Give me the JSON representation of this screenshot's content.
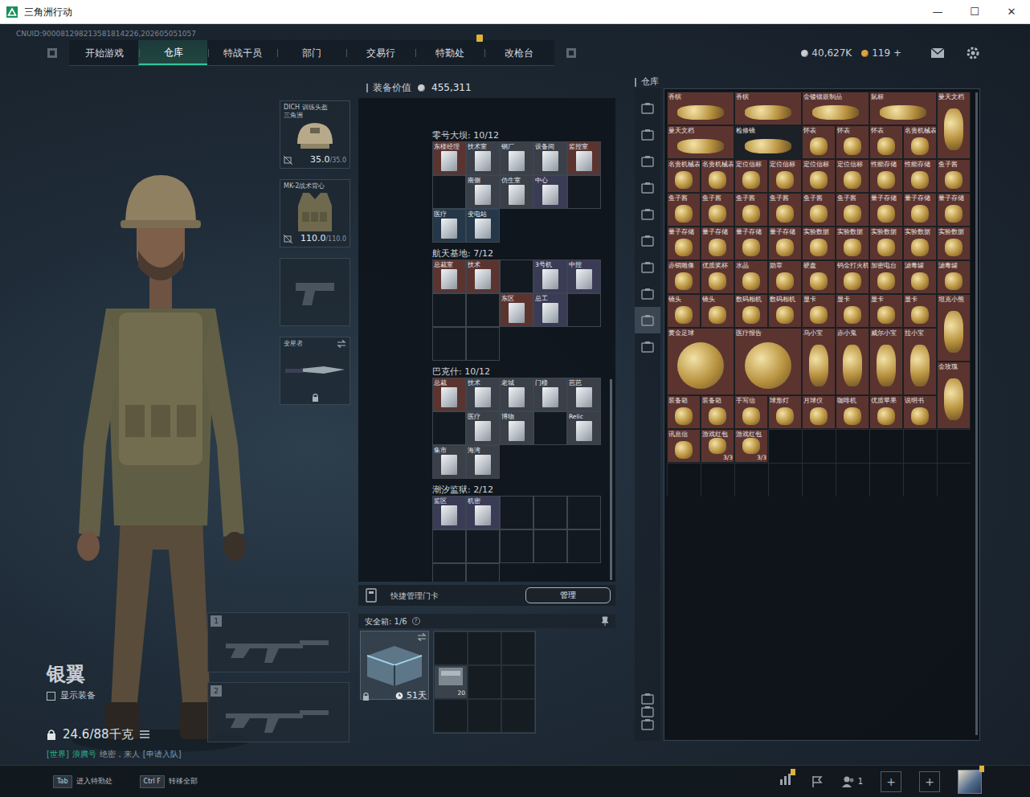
{
  "window": {
    "title": "三角洲行动",
    "controls": [
      {
        "label": "—"
      },
      {
        "label": "☐"
      },
      {
        "label": "✕"
      }
    ]
  },
  "uid": "CNUID:900081298213581814226,202605051057",
  "nav": {
    "tabs": [
      {
        "label": "开始游戏",
        "selected": false,
        "alert": false
      },
      {
        "label": "仓库",
        "selected": true,
        "alert": false
      },
      {
        "label": "特战干员",
        "selected": false,
        "alert": false
      },
      {
        "label": "部门",
        "selected": false,
        "alert": false
      },
      {
        "label": "交易行",
        "selected": false,
        "alert": false
      },
      {
        "label": "特勤处",
        "selected": false,
        "alert": true
      },
      {
        "label": "改枪台",
        "selected": false,
        "alert": false
      }
    ],
    "currency": [
      {
        "amount": "40,627K",
        "color": "#c9ccd0"
      },
      {
        "amount": "119 +",
        "color": "#d9a441"
      }
    ]
  },
  "character": {
    "name": "银翼",
    "show_equipment": {
      "label": "显示装备",
      "checked": false
    },
    "weight": "24.6/88千克",
    "chat": {
      "channel": "[世界]",
      "user": "浪腾号",
      "text": "绝密，来人",
      "link": "[申请入队]"
    }
  },
  "gear": [
    {
      "kind": "helmet",
      "name": "DICH 训练头盔",
      "sub": "三角洲",
      "value": "35.0",
      "max": "/35.0"
    },
    {
      "kind": "armor",
      "name": "MK-2战术背心",
      "value": "110.0",
      "max": "/110.0"
    },
    {
      "kind": "pistol"
    },
    {
      "kind": "melee",
      "name": "变星者",
      "locked": true
    }
  ],
  "weapons": [
    {
      "slot": "1"
    },
    {
      "slot": "2"
    }
  ],
  "loadout_value": {
    "label": "装备价值",
    "value": "455,311"
  },
  "keycards": [
    {
      "title": "零号大坝: 10/12",
      "slots": [
        {
          "owned": true,
          "label": "东楼经理",
          "color": "#5b3430"
        },
        {
          "owned": true,
          "label": "技术室",
          "color": "#3a3f48"
        },
        {
          "owned": true,
          "label": "钢厂",
          "color": "#3a3f48"
        },
        {
          "owned": true,
          "label": "设备间",
          "color": "#3a3f48"
        },
        {
          "owned": true,
          "label": "监控室",
          "color": "#5b3430"
        },
        {
          "owned": false
        },
        {
          "owned": true,
          "label": "南侧",
          "color": "#3a3f48"
        },
        {
          "owned": true,
          "label": "仿生室",
          "color": "#3a3f48"
        },
        {
          "owned": true,
          "label": "中心",
          "color": "#3a3b55"
        },
        {
          "owned": false
        },
        {
          "owned": true,
          "label": "医疗",
          "color": "#25384a"
        },
        {
          "owned": true,
          "label": "变电站",
          "color": "#25384a"
        }
      ]
    },
    {
      "title": "航天基地: 7/12",
      "slots": [
        {
          "owned": true,
          "label": "总裁室",
          "color": "#5b3430"
        },
        {
          "owned": true,
          "label": "技术",
          "color": "#5b3430"
        },
        {
          "owned": false
        },
        {
          "owned": true,
          "label": "3号机",
          "color": "#3a3b55"
        },
        {
          "owned": true,
          "label": "中控",
          "color": "#3a3b55"
        },
        {
          "owned": false
        },
        {
          "owned": false
        },
        {
          "owned": true,
          "label": "东区",
          "color": "#5b3430"
        },
        {
          "owned": true,
          "label": "总工",
          "color": "#3a3b55"
        },
        {
          "owned": false
        },
        {
          "owned": false
        },
        {
          "owned": false
        }
      ]
    },
    {
      "title": "巴克什: 10/12",
      "slots": [
        {
          "owned": true,
          "label": "总裁",
          "color": "#5b3430"
        },
        {
          "owned": true,
          "label": "技术",
          "color": "#3a3f48"
        },
        {
          "owned": true,
          "label": "老城",
          "color": "#3a3f48"
        },
        {
          "owned": true,
          "label": "门楼",
          "color": "#3a3f48"
        },
        {
          "owned": true,
          "label": "芭芭",
          "color": "#3a3f48"
        },
        {
          "owned": false
        },
        {
          "owned": true,
          "label": "医疗",
          "color": "#3a3f48"
        },
        {
          "owned": true,
          "label": "博物",
          "color": "#3a3f48"
        },
        {
          "owned": false
        },
        {
          "owned": true,
          "label": "Relic",
          "color": "#3a3f48"
        },
        {
          "owned": true,
          "label": "集市",
          "color": "#3a3f48"
        },
        {
          "owned": true,
          "label": "海湾",
          "color": "#3a3f48"
        }
      ]
    },
    {
      "title": "潮汐监狱: 2/12",
      "slots": [
        {
          "owned": true,
          "label": "监区",
          "color": "#3a3b55"
        },
        {
          "owned": true,
          "label": "机密",
          "color": "#3a3b55"
        },
        {
          "owned": false
        },
        {
          "owned": false
        },
        {
          "owned": false
        },
        {
          "owned": false
        },
        {
          "owned": false
        },
        {
          "owned": false
        },
        {
          "owned": false
        },
        {
          "owned": false
        },
        {
          "owned": false
        },
        {
          "owned": false
        }
      ]
    }
  ],
  "quick_cards": {
    "label": "快捷管理门卡",
    "button": "管理"
  },
  "safe_box": {
    "label": "安全箱: 1/6",
    "help": "?",
    "timer": "51天",
    "items": [
      {
        "count": "20"
      }
    ]
  },
  "warehouse": {
    "title": "仓库",
    "tabs": [
      {
        "selected": false
      },
      {
        "selected": false
      },
      {
        "selected": false
      },
      {
        "selected": false
      },
      {
        "selected": false
      },
      {
        "selected": false
      },
      {
        "selected": false
      },
      {
        "selected": false
      },
      {
        "selected": true
      },
      {
        "selected": false
      }
    ],
    "items": [
      {
        "label": "香槟",
        "kind": "wide",
        "color": "#5b3430"
      },
      {
        "label": "香槟",
        "kind": "wide",
        "color": "#5b3430"
      },
      {
        "label": "金镂镶嵌制品",
        "kind": "wide",
        "color": "#5b3430"
      },
      {
        "label": "鼠标",
        "kind": "wide",
        "color": "#5b3430"
      },
      {
        "label": "曼天文档",
        "kind": "tall",
        "color": "#5b3430"
      },
      {
        "label": "曼天文档",
        "kind": "wide",
        "color": "#5b3430"
      },
      {
        "label": "检修镜",
        "kind": "wide",
        "color": "#1c2127"
      },
      {
        "label": "怀表",
        "kind": "small",
        "color": "#5b3430"
      },
      {
        "label": "怀表",
        "kind": "small",
        "color": "#5b3430"
      },
      {
        "label": "怀表",
        "kind": "small",
        "color": "#5b3430"
      },
      {
        "label": "名贵机械表",
        "kind": "small",
        "color": "#5b3430"
      },
      {
        "label": "名贵机械表",
        "kind": "small",
        "color": "#5b3430"
      },
      {
        "label": "名贵机械表",
        "kind": "small",
        "color": "#5b3430"
      },
      {
        "label": "定位信标",
        "kind": "small",
        "color": "#5b3430"
      },
      {
        "label": "定位信标",
        "kind": "small",
        "color": "#5b3430"
      },
      {
        "label": "定位信标",
        "kind": "small",
        "color": "#5b3430"
      },
      {
        "label": "定位信标",
        "kind": "small",
        "color": "#5b3430"
      },
      {
        "label": "性能存储",
        "kind": "small",
        "color": "#5b3430"
      },
      {
        "label": "性能存储",
        "kind": "small",
        "color": "#5b3430"
      },
      {
        "label": "鱼子酱",
        "kind": "small",
        "color": "#5b3430"
      },
      {
        "label": "鱼子酱",
        "kind": "small",
        "color": "#5b3430"
      },
      {
        "label": "鱼子酱",
        "kind": "small",
        "color": "#5b3430"
      },
      {
        "label": "鱼子酱",
        "kind": "small",
        "color": "#5b3430"
      },
      {
        "label": "鱼子酱",
        "kind": "small",
        "color": "#5b3430"
      },
      {
        "label": "鱼子酱",
        "kind": "small",
        "color": "#5b3430"
      },
      {
        "label": "鱼子酱",
        "kind": "small",
        "color": "#5b3430"
      },
      {
        "label": "量子存储",
        "kind": "small",
        "color": "#5b3430"
      },
      {
        "label": "量子存储",
        "kind": "small",
        "color": "#5b3430"
      },
      {
        "label": "量子存储",
        "kind": "small",
        "color": "#5b3430"
      },
      {
        "label": "量子存储",
        "kind": "small",
        "color": "#5b3430"
      },
      {
        "label": "量子存储",
        "kind": "small",
        "color": "#5b3430"
      },
      {
        "label": "量子存储",
        "kind": "small",
        "color": "#5b3430"
      },
      {
        "label": "量子存储",
        "kind": "small",
        "color": "#5b3430"
      },
      {
        "label": "实验数据",
        "kind": "small",
        "color": "#5b3430"
      },
      {
        "label": "实验数据",
        "kind": "small",
        "color": "#5b3430"
      },
      {
        "label": "实验数据",
        "kind": "small",
        "color": "#5b3430"
      },
      {
        "label": "实验数据",
        "kind": "small",
        "color": "#5b3430"
      },
      {
        "label": "实验数据",
        "kind": "small",
        "color": "#5b3430"
      },
      {
        "label": "赤铜雕像",
        "kind": "small",
        "color": "#5b3430"
      },
      {
        "label": "优质奖杯",
        "kind": "small",
        "color": "#5b3430"
      },
      {
        "label": "水晶",
        "kind": "small",
        "color": "#5b3430"
      },
      {
        "label": "勋章",
        "kind": "small",
        "color": "#5b3430"
      },
      {
        "label": "硬盘",
        "kind": "small",
        "color": "#5b3430"
      },
      {
        "label": "钨金打火机",
        "kind": "small",
        "color": "#5b3430"
      },
      {
        "label": "加密电台",
        "kind": "small",
        "color": "#5b3430"
      },
      {
        "label": "滤毒罐",
        "kind": "small",
        "color": "#5b3430"
      },
      {
        "label": "滤毒罐",
        "kind": "small",
        "color": "#5b3430"
      },
      {
        "label": "镜头",
        "kind": "small",
        "color": "#5b3430"
      },
      {
        "label": "镜头",
        "kind": "small",
        "color": "#5b3430"
      },
      {
        "label": "数码相机",
        "kind": "small",
        "color": "#5b3430"
      },
      {
        "label": "数码相机",
        "kind": "small",
        "color": "#5b3430"
      },
      {
        "label": "显卡",
        "kind": "small",
        "color": "#5b3430"
      },
      {
        "label": "显卡",
        "kind": "small",
        "color": "#5b3430"
      },
      {
        "label": "显卡",
        "kind": "small",
        "color": "#5b3430"
      },
      {
        "label": "显卡",
        "kind": "small",
        "color": "#5b3430"
      },
      {
        "label": "坦克小熊",
        "kind": "tall",
        "color": "#5b3430"
      },
      {
        "label": "黄金足球",
        "kind": "large",
        "color": "#5b3430"
      },
      {
        "label": "医疗报告",
        "kind": "large",
        "color": "#5b3430"
      },
      {
        "label": "乌小宝",
        "kind": "tall",
        "color": "#5b3430"
      },
      {
        "label": "赤小鬼",
        "kind": "tall",
        "color": "#5b3430"
      },
      {
        "label": "威尔小宝",
        "kind": "tall",
        "color": "#5b3430"
      },
      {
        "label": "拉小宝",
        "kind": "tall",
        "color": "#5b3430"
      },
      {
        "label": "金玫瑰",
        "kind": "tall",
        "color": "#5b3430"
      },
      {
        "label": "装备箱",
        "kind": "small",
        "color": "#5b3430"
      },
      {
        "label": "装备箱",
        "kind": "small",
        "color": "#5b3430"
      },
      {
        "label": "手写信",
        "kind": "small",
        "color": "#5b3430"
      },
      {
        "label": "球形灯",
        "kind": "small",
        "color": "#5b3430"
      },
      {
        "label": "月球仪",
        "kind": "small",
        "color": "#5b3430"
      },
      {
        "label": "咖啡机",
        "kind": "small",
        "color": "#5b3430"
      },
      {
        "label": "优质苹果",
        "kind": "small",
        "color": "#5b3430"
      },
      {
        "label": "说明书",
        "kind": "small",
        "color": "#5b3430"
      },
      {
        "label": "讯息信",
        "kind": "small",
        "color": "#5b3430"
      },
      {
        "label": "游戏红包",
        "kind": "small",
        "color": "#5b3430",
        "count": "3/3"
      },
      {
        "label": "游戏红包",
        "kind": "small",
        "color": "#5b3430",
        "count": "3/3"
      }
    ]
  },
  "bottom_bar": {
    "hints": [
      {
        "key": "Tab",
        "label": "进入特勤处"
      },
      {
        "key": "Ctrl F",
        "label": "转移全部"
      }
    ],
    "stats_alert": true,
    "friends": "1",
    "slots": [
      "+",
      "+"
    ],
    "avatar_alert": true
  }
}
